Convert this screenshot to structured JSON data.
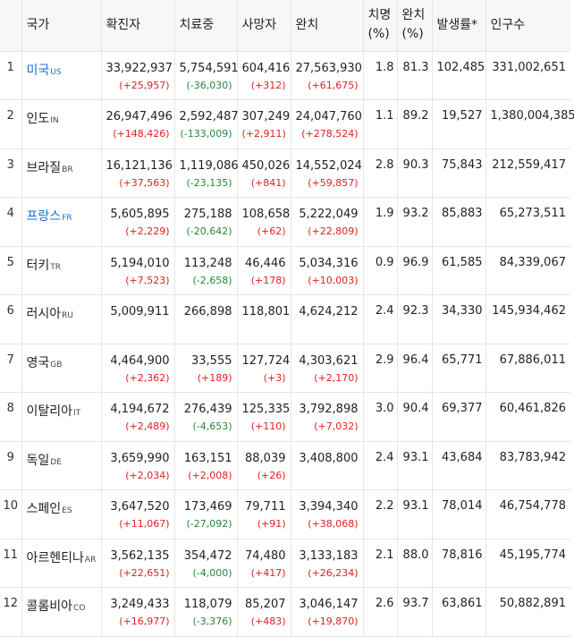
{
  "colors": {
    "increase": "#e02020",
    "decrease": "#22883a",
    "link": "#1a6fd0"
  },
  "header": {
    "country": "국가",
    "confirmed": "확진자",
    "treating": "치료중",
    "deaths": "사망자",
    "recovered": "완치",
    "fatality": "치명\n(%)",
    "recovery_rate": "완치\n(%)",
    "incidence": "발생률*",
    "population": "인구수"
  },
  "rows": [
    {
      "index": "1",
      "name": "미국",
      "code": "US",
      "link": true,
      "confirmed": "33,922,937",
      "confirmed_delta": "(+25,957)",
      "treating": "5,754,591",
      "treating_delta": "(-36,030)",
      "deaths": "604,416",
      "deaths_delta": "(+312)",
      "recovered": "27,563,930",
      "recovered_delta": "(+61,675)",
      "fatality": "1.8",
      "recovery_rate": "81.3",
      "incidence": "102,485",
      "population": "331,002,651"
    },
    {
      "index": "2",
      "name": "인도",
      "code": "IN",
      "link": false,
      "confirmed": "26,947,496",
      "confirmed_delta": "(+148,426)",
      "treating": "2,592,487",
      "treating_delta": "(-133,009)",
      "deaths": "307,249",
      "deaths_delta": "(+2,911)",
      "recovered": "24,047,760",
      "recovered_delta": "(+278,524)",
      "fatality": "1.1",
      "recovery_rate": "89.2",
      "incidence": "19,527",
      "population": "1,380,004,385"
    },
    {
      "index": "3",
      "name": "브라질",
      "code": "BR",
      "link": false,
      "confirmed": "16,121,136",
      "confirmed_delta": "(+37,563)",
      "treating": "1,119,086",
      "treating_delta": "(-23,135)",
      "deaths": "450,026",
      "deaths_delta": "(+841)",
      "recovered": "14,552,024",
      "recovered_delta": "(+59,857)",
      "fatality": "2.8",
      "recovery_rate": "90.3",
      "incidence": "75,843",
      "population": "212,559,417"
    },
    {
      "index": "4",
      "name": "프랑스",
      "code": "FR",
      "link": true,
      "confirmed": "5,605,895",
      "confirmed_delta": "(+2,229)",
      "treating": "275,188",
      "treating_delta": "(-20,642)",
      "deaths": "108,658",
      "deaths_delta": "(+62)",
      "recovered": "5,222,049",
      "recovered_delta": "(+22,809)",
      "fatality": "1.9",
      "recovery_rate": "93.2",
      "incidence": "85,883",
      "population": "65,273,511"
    },
    {
      "index": "5",
      "name": "터키",
      "code": "TR",
      "link": false,
      "confirmed": "5,194,010",
      "confirmed_delta": "(+7,523)",
      "treating": "113,248",
      "treating_delta": "(-2,658)",
      "deaths": "46,446",
      "deaths_delta": "(+178)",
      "recovered": "5,034,316",
      "recovered_delta": "(+10,003)",
      "fatality": "0.9",
      "recovery_rate": "96.9",
      "incidence": "61,585",
      "population": "84,339,067"
    },
    {
      "index": "6",
      "name": "러시아",
      "code": "RU",
      "link": false,
      "confirmed": "5,009,911",
      "confirmed_delta": "",
      "treating": "266,898",
      "treating_delta": "",
      "deaths": "118,801",
      "deaths_delta": "",
      "recovered": "4,624,212",
      "recovered_delta": "",
      "fatality": "2.4",
      "recovery_rate": "92.3",
      "incidence": "34,330",
      "population": "145,934,462"
    },
    {
      "index": "7",
      "name": "영국",
      "code": "GB",
      "link": false,
      "confirmed": "4,464,900",
      "confirmed_delta": "(+2,362)",
      "treating": "33,555",
      "treating_delta": "(+189)",
      "deaths": "127,724",
      "deaths_delta": "(+3)",
      "recovered": "4,303,621",
      "recovered_delta": "(+2,170)",
      "fatality": "2.9",
      "recovery_rate": "96.4",
      "incidence": "65,771",
      "population": "67,886,011"
    },
    {
      "index": "8",
      "name": "이탈리아",
      "code": "IT",
      "link": false,
      "confirmed": "4,194,672",
      "confirmed_delta": "(+2,489)",
      "treating": "276,439",
      "treating_delta": "(-4,653)",
      "deaths": "125,335",
      "deaths_delta": "(+110)",
      "recovered": "3,792,898",
      "recovered_delta": "(+7,032)",
      "fatality": "3.0",
      "recovery_rate": "90.4",
      "incidence": "69,377",
      "population": "60,461,826"
    },
    {
      "index": "9",
      "name": "독일",
      "code": "DE",
      "link": false,
      "confirmed": "3,659,990",
      "confirmed_delta": "(+2,034)",
      "treating": "163,151",
      "treating_delta": "(+2,008)",
      "deaths": "88,039",
      "deaths_delta": "(+26)",
      "recovered": "3,408,800",
      "recovered_delta": "",
      "fatality": "2.4",
      "recovery_rate": "93.1",
      "incidence": "43,684",
      "population": "83,783,942"
    },
    {
      "index": "10",
      "name": "스페인",
      "code": "ES",
      "link": false,
      "confirmed": "3,647,520",
      "confirmed_delta": "(+11,067)",
      "treating": "173,469",
      "treating_delta": "(-27,092)",
      "deaths": "79,711",
      "deaths_delta": "(+91)",
      "recovered": "3,394,340",
      "recovered_delta": "(+38,068)",
      "fatality": "2.2",
      "recovery_rate": "93.1",
      "incidence": "78,014",
      "population": "46,754,778"
    },
    {
      "index": "11",
      "name": "아르헨티나",
      "code": "AR",
      "link": false,
      "confirmed": "3,562,135",
      "confirmed_delta": "(+22,651)",
      "treating": "354,472",
      "treating_delta": "(-4,000)",
      "deaths": "74,480",
      "deaths_delta": "(+417)",
      "recovered": "3,133,183",
      "recovered_delta": "(+26,234)",
      "fatality": "2.1",
      "recovery_rate": "88.0",
      "incidence": "78,816",
      "population": "45,195,774"
    },
    {
      "index": "12",
      "name": "콜롬비아",
      "code": "CO",
      "link": false,
      "confirmed": "3,249,433",
      "confirmed_delta": "(+16,977)",
      "treating": "118,079",
      "treating_delta": "(-3,376)",
      "deaths": "85,207",
      "deaths_delta": "(+483)",
      "recovered": "3,046,147",
      "recovered_delta": "(+19,870)",
      "fatality": "2.6",
      "recovery_rate": "93.7",
      "incidence": "63,861",
      "population": "50,882,891"
    }
  ]
}
